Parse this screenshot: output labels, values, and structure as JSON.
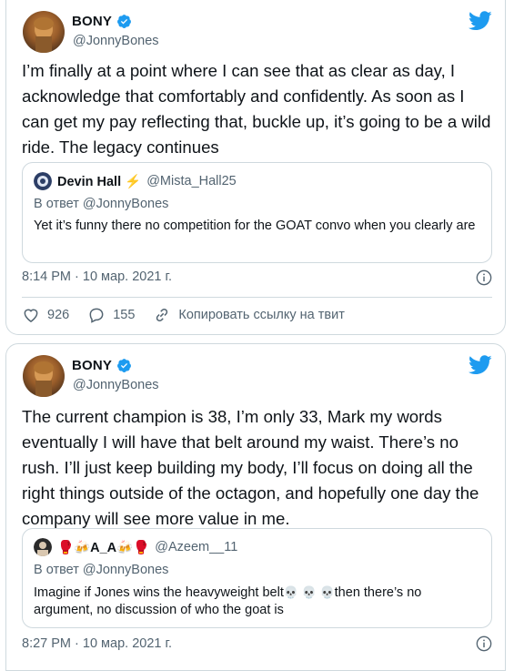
{
  "tweets": [
    {
      "author": {
        "name": "BONY",
        "handle": "@JonnyBones"
      },
      "text": "I’m finally at a point where I can see that as clear as day, I acknowledge that comfortably and confidently. As soon as I can get my pay reflecting that, buckle up, it’s going to be a wild ride. The legacy continues",
      "quote": {
        "name": "Devin Hall ⚡",
        "handle": "@Mista_Hall25",
        "reply_to": "В ответ @JonnyBones",
        "text": "Yet it’s funny there no competition for the GOAT convo when you clearly are"
      },
      "timestamp": "8:14 PM · 10 мар. 2021 г.",
      "actions": {
        "likes": "926",
        "replies": "155",
        "copy_link": "Копировать ссылку на твит"
      }
    },
    {
      "author": {
        "name": "BONY",
        "handle": "@JonnyBones"
      },
      "text": "The current champion is 38, I’m only 33, Mark my words eventually I will have that belt around my waist. There’s no rush. I’ll just keep building my body, I’ll focus on doing all the right things outside of the octagon, and hopefully one day the company will see more value in me.",
      "quote": {
        "name": "🥊🍻A_A🍻🥊",
        "handle": "@Azeem__11",
        "reply_to": "В ответ @JonnyBones",
        "text_before": "Imagine if Jones wins the heavyweight belt",
        "skulls": "💀 💀 💀",
        "text_after": "then there’s no argument, no discussion of who the goat is"
      },
      "timestamp": "8:27 PM · 10 мар. 2021 г."
    }
  ],
  "colors": {
    "twitter_blue": "#1d9bf0",
    "secondary_text": "#536471",
    "border": "#cfd9de"
  }
}
